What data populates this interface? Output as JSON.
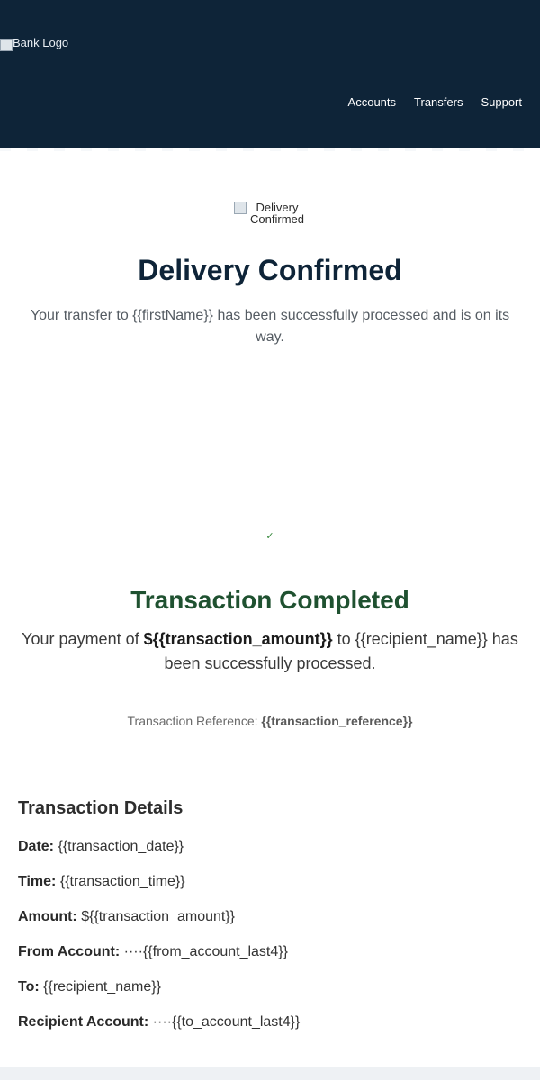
{
  "header": {
    "logo_alt": "Bank Logo",
    "nav": [
      "Accounts",
      "Transfers",
      "Support"
    ]
  },
  "hero": {
    "image_alt": "Delivery Confirmed",
    "title": "Delivery Confirmed",
    "subtitle": "Your transfer to {{firstName}} has been successfully processed and is on its way."
  },
  "completion": {
    "check_icon": "✓",
    "title": "Transaction Completed",
    "message_prefix": "Your payment of ",
    "message_amount": "${{transaction_amount}}",
    "message_middle": " to {{recipient_name}} has been successfully processed.",
    "reference_label": "Transaction Reference: ",
    "reference_value": "{{transaction_reference}}"
  },
  "details": {
    "heading": "Transaction Details",
    "rows": [
      {
        "label": "Date:",
        "value": "{{transaction_date}}"
      },
      {
        "label": "Time:",
        "value": "{{transaction_time}}"
      },
      {
        "label": "Amount:",
        "value": "${{transaction_amount}}"
      },
      {
        "label": "From Account:",
        "value": "····{{from_account_last4}}"
      },
      {
        "label": "To:",
        "value": "{{recipient_name}}"
      },
      {
        "label": "Recipient Account:",
        "value": "····{{to_account_last4}}"
      }
    ]
  },
  "colors": {
    "header_bg": "#0e2438",
    "completed_green": "#1f5130",
    "check_green": "#3a8a3f"
  }
}
